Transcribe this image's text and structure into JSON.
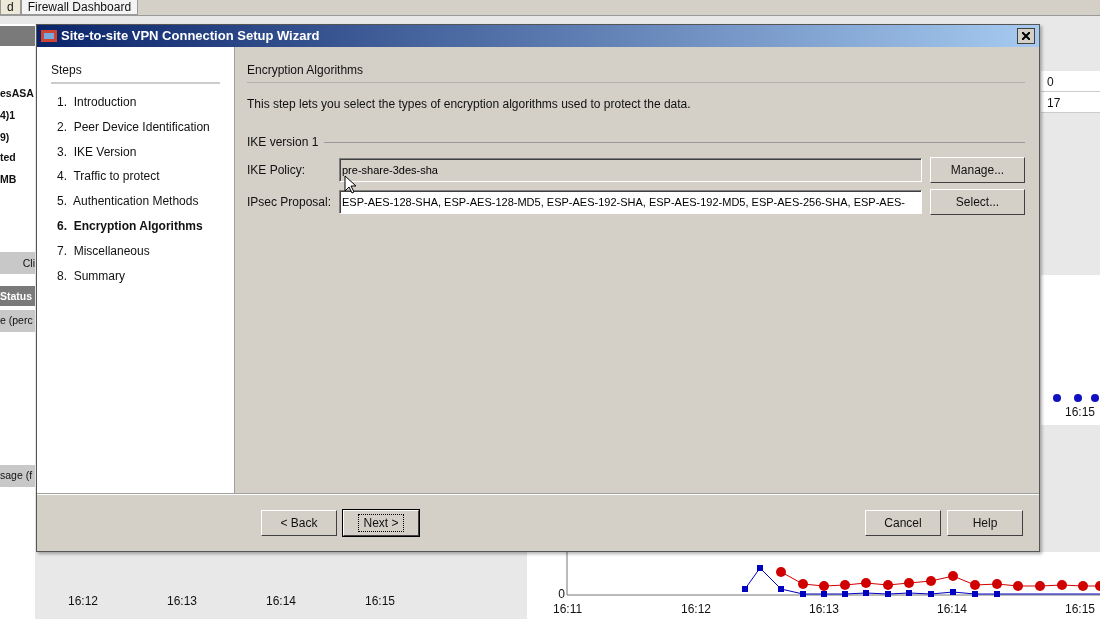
{
  "background": {
    "tabs": [
      {
        "label": "d",
        "selected": false
      },
      {
        "label": "Firewall Dashboard",
        "selected": true
      }
    ],
    "left_lines": [
      "esASA",
      "4)1",
      "9)",
      "ted",
      "MB"
    ],
    "left_tab": "Cli",
    "left_headers": [
      "Status",
      "e (perc",
      "sage (f"
    ],
    "right_cells": [
      "0",
      "17"
    ],
    "upper_right_xticks": [
      "16:15"
    ],
    "lower_left_xticks": [
      "16:12",
      "16:13",
      "16:14",
      "16:15"
    ],
    "lower_right_yticks": [
      "0"
    ],
    "lower_right_xticks": [
      "16:11",
      "16:12",
      "16:13",
      "16:14",
      "16:15"
    ]
  },
  "dialog": {
    "title": "Site-to-site VPN Connection Setup Wizard",
    "steps": {
      "heading": "Steps",
      "items": [
        {
          "number": "1.",
          "label": "Introduction",
          "selected": false
        },
        {
          "number": "2.",
          "label": "Peer Device Identification",
          "selected": false
        },
        {
          "number": "3.",
          "label": "IKE Version",
          "selected": false
        },
        {
          "number": "4.",
          "label": "Traffic to protect",
          "selected": false
        },
        {
          "number": "5.",
          "label": "Authentication Methods",
          "selected": false
        },
        {
          "number": "6.",
          "label": "Encryption Algorithms",
          "selected": true
        },
        {
          "number": "7.",
          "label": "Miscellaneous",
          "selected": false
        },
        {
          "number": "8.",
          "label": "Summary",
          "selected": false
        }
      ]
    },
    "content": {
      "heading": "Encryption Algorithms",
      "description": "This step lets you select the types of encryption algorithms used to protect the data.",
      "group": "IKE version 1",
      "fields": [
        {
          "label": "IKE Policy:",
          "value": "pre-share-3des-sha",
          "disabled": true,
          "button": "Manage..."
        },
        {
          "label": "IPsec Proposal:",
          "value": "ESP-AES-128-SHA, ESP-AES-128-MD5, ESP-AES-192-SHA, ESP-AES-192-MD5, ESP-AES-256-SHA, ESP-AES-",
          "disabled": false,
          "button": "Select..."
        }
      ]
    },
    "nav_buttons": [
      {
        "label": "< Back",
        "default": false
      },
      {
        "label": "Next >",
        "default": true
      }
    ],
    "side_buttons": [
      {
        "label": "Cancel",
        "default": false
      },
      {
        "label": "Help",
        "default": false
      }
    ]
  }
}
